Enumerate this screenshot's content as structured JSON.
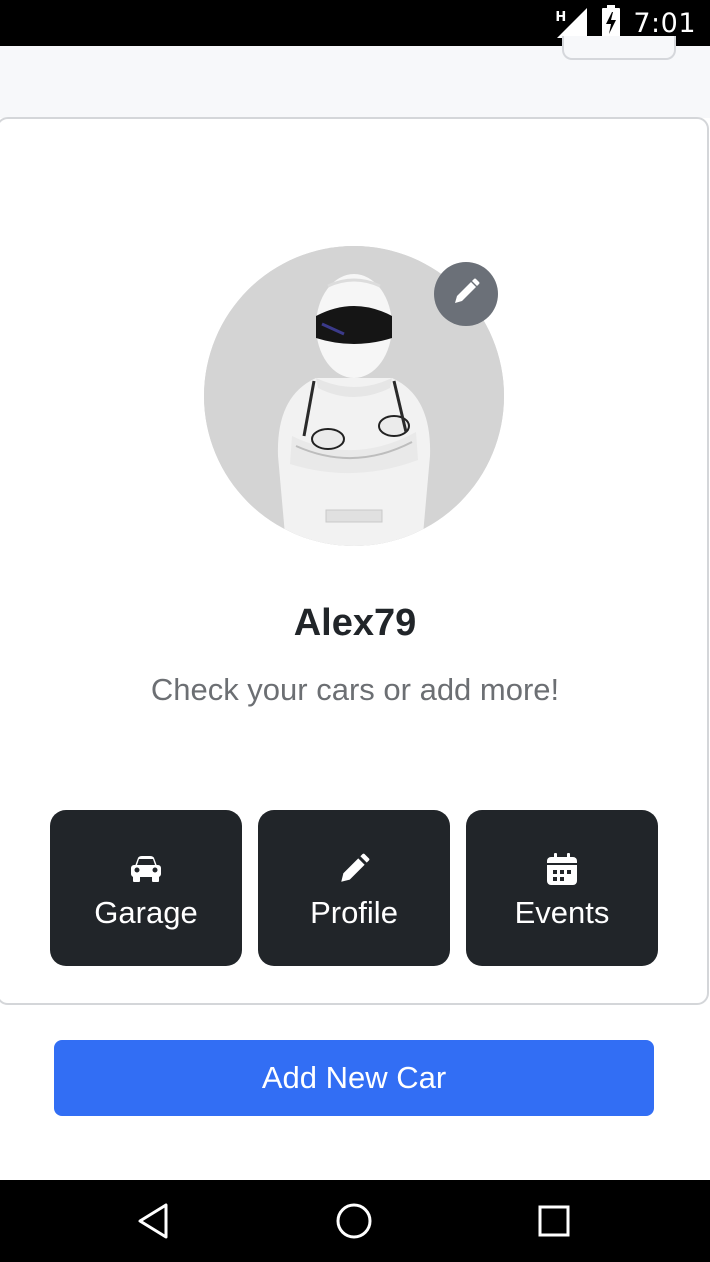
{
  "status_bar": {
    "time": "7:01",
    "network_type": "H",
    "icons": [
      "signal-icon",
      "battery-charging-icon"
    ]
  },
  "profile": {
    "username": "Alex79",
    "tagline": "Check your cars or add more!",
    "avatar_icon": "avatar",
    "edit_icon": "pencil-icon"
  },
  "actions": [
    {
      "label": "Garage",
      "icon": "car-icon"
    },
    {
      "label": "Profile",
      "icon": "pencil-icon"
    },
    {
      "label": "Events",
      "icon": "calendar-icon"
    }
  ],
  "add_car_label": "Add New Car",
  "nav_bar": {
    "icons": [
      "back-icon",
      "home-icon",
      "recents-icon"
    ]
  },
  "colors": {
    "primary": "#326ef4",
    "dark": "#212529",
    "muted_text": "#6c6f73",
    "avatar_edit_bg": "#6b7078"
  }
}
